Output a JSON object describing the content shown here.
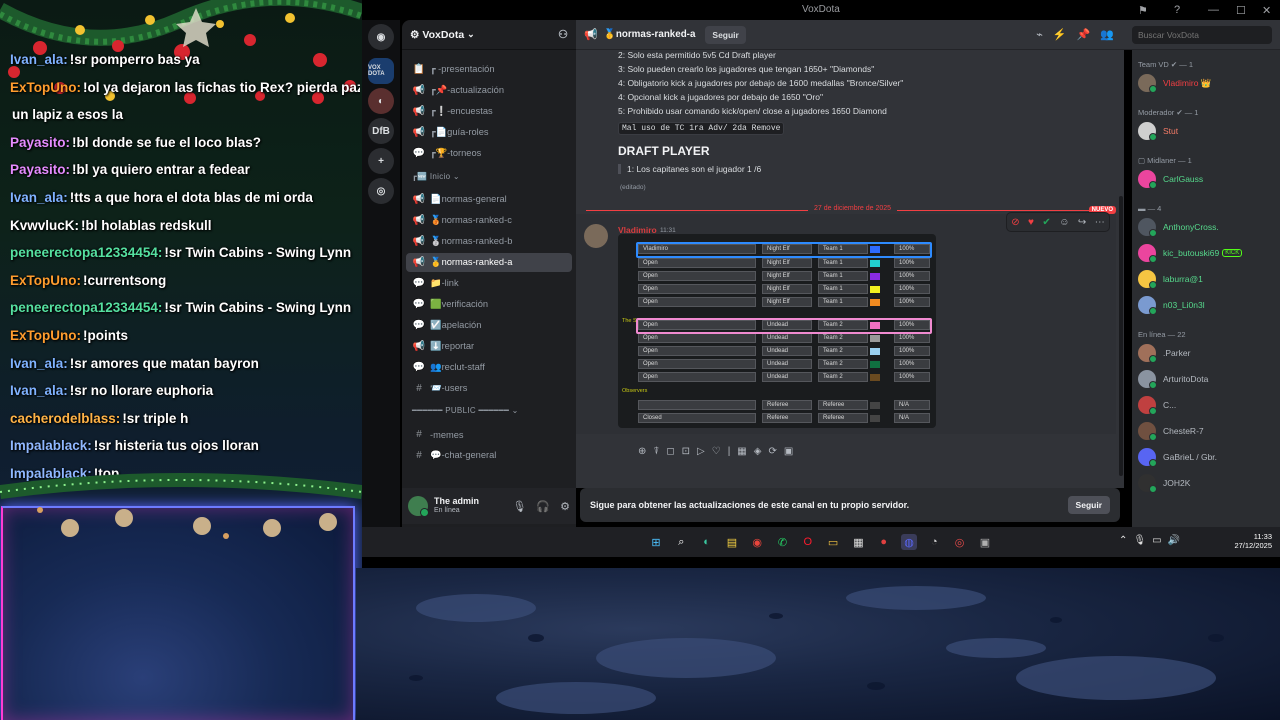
{
  "chat": {
    "messages": [
      {
        "user": "Ivan_ala:",
        "text": "!sr pomperro bas  ya",
        "color": "#7fb2ff"
      },
      {
        "user": "ExTopUno:",
        "text": "!ol ya dejaron las fichas tio Rex? pierda paz de",
        "color": "#ff9d2e"
      },
      {
        "user": "",
        "text": "un lapiz a esos la",
        "color": "#ffffff"
      },
      {
        "user": "Payasito:",
        "text": "!bl donde se fue el loco blas?",
        "color": "#e58cff"
      },
      {
        "user": "Payasito:",
        "text": "!bl ya quiero entrar a fedear",
        "color": "#e58cff"
      },
      {
        "user": "Ivan_ala:",
        "text": "!tts a que hora el dota blas de mi orda",
        "color": "#7fb2ff"
      },
      {
        "user": "KvwvlucK:",
        "text": "!bl holablas redskull",
        "color": "#ffffff"
      },
      {
        "user": "peneerectopa12334454:",
        "text": "!sr Twin Cabins - Swing Lynn",
        "color": "#55e0a0"
      },
      {
        "user": "ExTopUno:",
        "text": "!currentsong",
        "color": "#ff9d2e"
      },
      {
        "user": "peneerectopa12334454:",
        "text": "!sr Twin Cabins - Swing Lynn",
        "color": "#55e0a0"
      },
      {
        "user": "ExTopUno:",
        "text": "!points",
        "color": "#ff9d2e"
      },
      {
        "user": "Ivan_ala:",
        "text": "!sr amores que matan bayron",
        "color": "#7fb2ff"
      },
      {
        "user": "Ivan_ala:",
        "text": "!sr no llorare euphoria",
        "color": "#7fb2ff"
      },
      {
        "user": "cacherodelblass:",
        "text": "!sr triple h",
        "color": "#ffb347"
      },
      {
        "user": "Impalablack:",
        "text": "!sr histeria tus ojos lloran",
        "color": "#8fb7ff"
      },
      {
        "user": "Impalablack:",
        "text": "!top",
        "color": "#8fb7ff"
      }
    ]
  },
  "window": {
    "title": "VoxDota"
  },
  "servers": [
    {
      "label": "",
      "icon": "discord-icon"
    },
    {
      "label": "VOX DOTA",
      "icon": "voxdota-icon"
    },
    {
      "label": "",
      "icon": "server-icon"
    },
    {
      "label": "DfB",
      "icon": "dfb-icon"
    },
    {
      "label": "+",
      "icon": "add-server-icon"
    },
    {
      "label": "◎",
      "icon": "discover-icon"
    }
  ],
  "guild": {
    "name": "VoxDota"
  },
  "channels": [
    {
      "icon": "📋",
      "label": "┏ -presentación"
    },
    {
      "icon": "📢",
      "label": "┏📌-actualización"
    },
    {
      "icon": "📢",
      "label": "┏❕-encuestas"
    },
    {
      "icon": "📢",
      "label": "┏📄guía-roles"
    },
    {
      "icon": "💬",
      "label": "┏🏆-torneos"
    },
    {
      "icon": "",
      "label": "┏🆕 Inicio ⌄",
      "category": true
    },
    {
      "icon": "📢",
      "label": "📄normas-general"
    },
    {
      "icon": "📢",
      "label": "🥉normas-ranked-c"
    },
    {
      "icon": "📢",
      "label": "🥈normas-ranked-b"
    },
    {
      "icon": "📢",
      "label": "🥇normas-ranked-a",
      "active": true
    },
    {
      "icon": "💬",
      "label": "📁-link"
    },
    {
      "icon": "💬",
      "label": "🟩verificación"
    },
    {
      "icon": "💬",
      "label": "☑️apelación"
    },
    {
      "icon": "📢",
      "label": "⬇️reportar"
    },
    {
      "icon": "💬",
      "label": "👥reclut-staff"
    },
    {
      "icon": "#",
      "label": "📨-users"
    },
    {
      "icon": "",
      "label": "━━━━━━ PUBLIC ━━━━━━ ⌄",
      "category": true
    },
    {
      "icon": "#",
      "label": "-memes"
    },
    {
      "icon": "#",
      "label": "💬-chat-general"
    }
  ],
  "user": {
    "name": "The admin",
    "status": "En línea"
  },
  "header": {
    "channel": "🥇normas-ranked-a",
    "follow": "Seguir",
    "search_placeholder": "Buscar VoxDota"
  },
  "rules": [
    "2: Solo esta permitido 5v5 Cd Draft player",
    "3: Solo pueden crearlo los jugadores que tengan 1650+ \"Diamonds\"",
    "4: Obligatorio kick a jugadores por debajo de 1600 medallas \"Bronce/Silver\"",
    "4: Opcional kick a jugadores por debajo de 1650 \"Oro\"",
    "5: Prohibido usar comando kick/open/ close a jugadores 1650 Diamond"
  ],
  "code_note": "Mal uso de TC 1ra Adv/ 2da Remove",
  "section_title": "DRAFT PLAYER",
  "quote": "1: Los capitanes son el jugador 1 /6",
  "edited": "(editado)",
  "divider": {
    "date": "27 de diciembre de 2025",
    "badge": "NUEVO"
  },
  "message": {
    "author": "Vladimiro",
    "time": "11:31"
  },
  "lobby": {
    "rows": [
      {
        "name": "Vladimiro",
        "race": "Night Elf",
        "team": "Team 1",
        "pct": "100%",
        "color": "#2e6bff"
      },
      {
        "name": "Open",
        "race": "Night Elf",
        "team": "Team 1",
        "pct": "100%",
        "color": "#22d0d0"
      },
      {
        "name": "Open",
        "race": "Night Elf",
        "team": "Team 1",
        "pct": "100%",
        "color": "#8a2be2"
      },
      {
        "name": "Open",
        "race": "Night Elf",
        "team": "Team 1",
        "pct": "100%",
        "color": "#f0f020"
      },
      {
        "name": "Open",
        "race": "Night Elf",
        "team": "Team 1",
        "pct": "100%",
        "color": "#f08a20"
      },
      {
        "name": "Open",
        "race": "Undead",
        "team": "Team 2",
        "pct": "100%",
        "color": "#f070c0"
      },
      {
        "name": "Open",
        "race": "Undead",
        "team": "Team 2",
        "pct": "100%",
        "color": "#9a9a9a"
      },
      {
        "name": "Open",
        "race": "Undead",
        "team": "Team 2",
        "pct": "100%",
        "color": "#9ad0f0"
      },
      {
        "name": "Open",
        "race": "Undead",
        "team": "Team 2",
        "pct": "100%",
        "color": "#107040"
      },
      {
        "name": "Open",
        "race": "Undead",
        "team": "Team 2",
        "pct": "100%",
        "color": "#6a4a20"
      },
      {
        "name": "",
        "race": "Referee",
        "team": "Referee",
        "pct": "N/A",
        "color": "#444444"
      },
      {
        "name": "Closed",
        "race": "Referee",
        "team": "Referee",
        "pct": "N/A",
        "color": "#444444"
      }
    ],
    "team2_label": "The Scourge",
    "observers_label": "Observers"
  },
  "follow_banner": {
    "text": "Sigue para obtener las actualizaciones de este canal en tu propio servidor.",
    "button": "Seguir"
  },
  "members": {
    "groups": [
      {
        "label": "Team VD ✔ — 1",
        "members": [
          {
            "name": "Vladimiro 👑",
            "color": "#f23f43",
            "avatar": "#7a6a5a"
          }
        ]
      },
      {
        "label": "Moderador ✔ — 1",
        "members": [
          {
            "name": "Stut",
            "color": "#f47b67",
            "avatar": "#cfcfcf"
          }
        ]
      },
      {
        "label": "▢ Midlaner — 1",
        "members": [
          {
            "name": "CarlGauss",
            "color": "#56d98c",
            "avatar": "#eb459e"
          }
        ]
      },
      {
        "label": "▬ — 4",
        "members": [
          {
            "name": "AnthonyCross.",
            "color": "#56d98c",
            "avatar": "#4f5660"
          },
          {
            "name": "kic_butouski69",
            "color": "#56d98c",
            "avatar": "#eb459e",
            "badge": "KICK"
          },
          {
            "name": "laburra@1",
            "color": "#56d98c",
            "avatar": "#f5c542"
          },
          {
            "name": "n03_Li0n3l",
            "color": "#56d98c",
            "avatar": "#7a9ad0"
          }
        ]
      },
      {
        "label": "En línea — 22",
        "members": [
          {
            "name": ".Parker",
            "color": "#b5bac1",
            "avatar": "#a0705a"
          },
          {
            "name": "ArturitoDota",
            "color": "#b5bac1",
            "avatar": "#8a93a0"
          },
          {
            "name": "C...",
            "color": "#b5bac1",
            "avatar": "#c04040"
          },
          {
            "name": "ChesteR-7",
            "color": "#b5bac1",
            "avatar": "#705040"
          },
          {
            "name": "GaBrieL / Gbr.",
            "color": "#b5bac1",
            "avatar": "#5865f2"
          },
          {
            "name": "JOH2K",
            "color": "#b5bac1",
            "avatar": "#303030"
          }
        ]
      }
    ]
  },
  "taskbar": {
    "apps": [
      "windows-start-icon",
      "search-icon",
      "edge-icon",
      "sticky-icon",
      "chrome-icon",
      "whatsapp-icon",
      "opera-icon",
      "explorer-icon",
      "store-icon",
      "app-red-icon",
      "discord-icon",
      "app-circle-icon",
      "app-chrome2-icon",
      "app-dark-icon"
    ],
    "time": "11:33",
    "date": "27/12/2025"
  }
}
